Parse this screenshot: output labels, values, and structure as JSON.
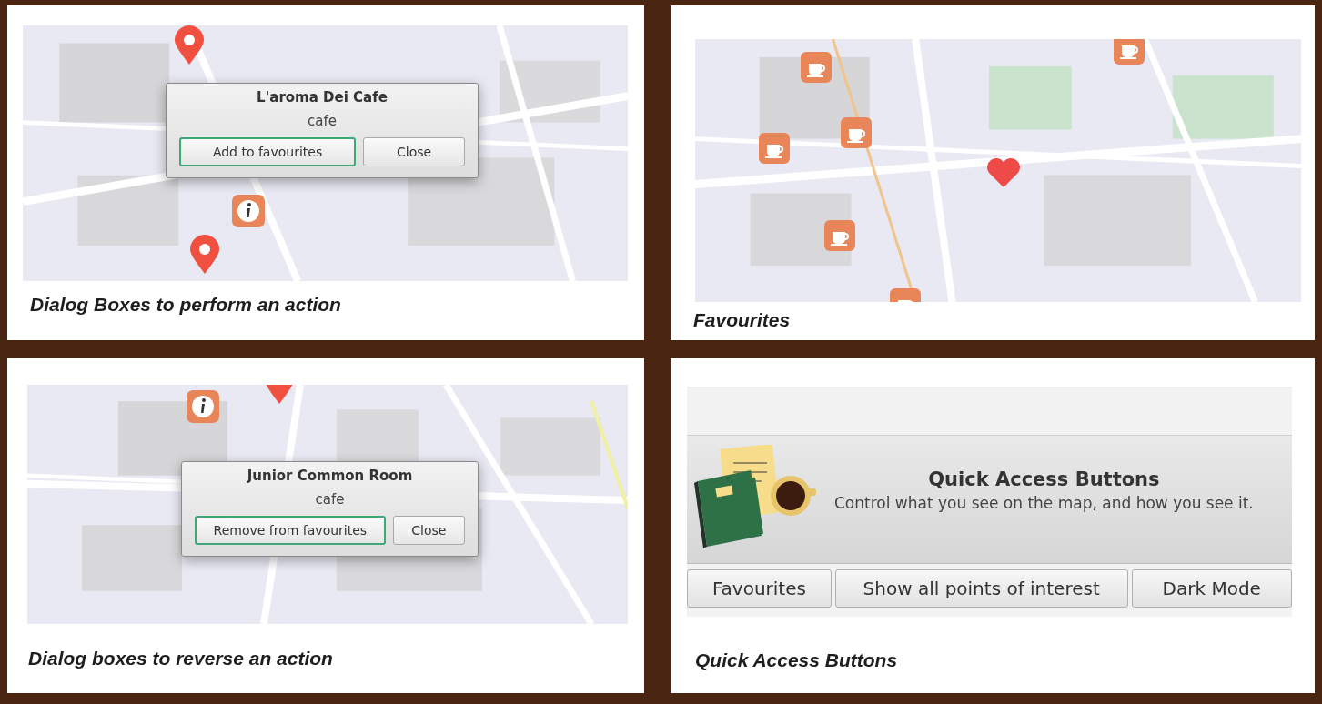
{
  "panels": [
    {
      "kind": "dialog_map",
      "dialog": {
        "title": "L'aroma Dei Cafe",
        "subtitle": "cafe",
        "buttons": [
          {
            "label": "Add to favourites",
            "focused": true
          },
          {
            "label": "Close",
            "focused": false
          }
        ]
      },
      "caption": "Dialog Boxes to perform an action"
    },
    {
      "kind": "map",
      "caption": "Favourites"
    },
    {
      "kind": "dialog_map",
      "dialog": {
        "title": "Junior Common Room",
        "subtitle": "cafe",
        "buttons": [
          {
            "label": "Remove from favourites",
            "focused": true
          },
          {
            "label": "Close",
            "focused": false
          }
        ]
      },
      "caption": "Dialog boxes to reverse an action"
    },
    {
      "kind": "app",
      "header": {
        "title": "Quick Access Buttons",
        "subtitle": "Control what you see on the map, and how you see it."
      },
      "buttons": [
        {
          "label": "Favourites"
        },
        {
          "label": "Show all points of interest"
        },
        {
          "label": "Dark Mode"
        }
      ],
      "caption": "Quick Access Buttons"
    }
  ]
}
